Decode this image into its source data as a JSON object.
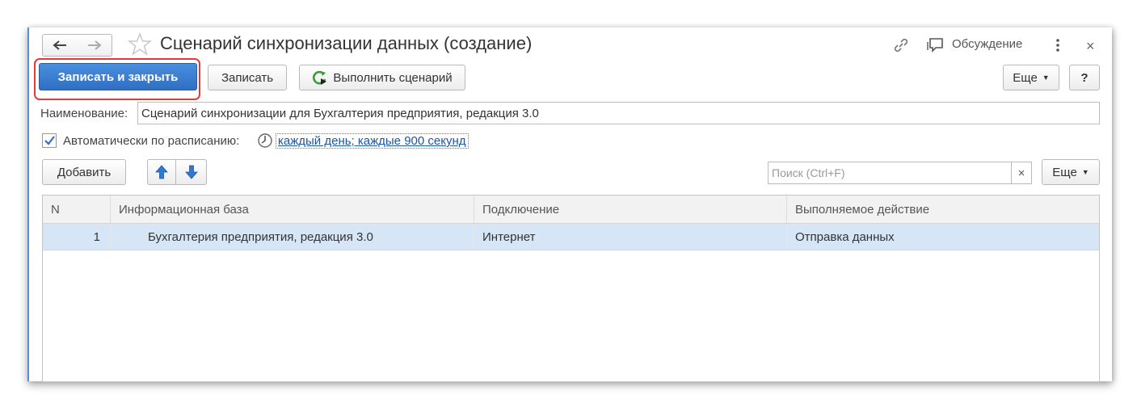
{
  "header": {
    "title": "Сценарий синхронизации данных (создание)",
    "discussion_label": "Обсуждение",
    "icons": [
      "arrow-left-icon",
      "arrow-right-icon",
      "star-icon",
      "link-icon",
      "discussion-icon",
      "more-vert-icon",
      "close-icon"
    ]
  },
  "toolbar": {
    "save_close_label": "Записать и закрыть",
    "save_label": "Записать",
    "run_scenario_label": "Выполнить сценарий",
    "more_label": "Еще",
    "help_label": "?"
  },
  "form": {
    "name_label": "Наименование:",
    "name_value": "Сценарий синхронизации для Бухгалтерия предприятия, редакция 3.0",
    "auto_schedule_label": "Автоматически по расписанию:",
    "auto_schedule_checked": true,
    "schedule_link": "каждый день; каждые 900 секунд"
  },
  "table_toolbar": {
    "add_label": "Добавить",
    "search_placeholder": "Поиск (Ctrl+F)",
    "clear_label": "×",
    "more_label": "Еще"
  },
  "table": {
    "columns": [
      "N",
      "Информационная база",
      "Подключение",
      "Выполняемое действие"
    ],
    "rows": [
      {
        "n": "1",
        "base": "Бухгалтерия предприятия, редакция 3.0",
        "connection": "Интернет",
        "action": "Отправка данных"
      }
    ]
  },
  "colors": {
    "accent": "#2f6fc4",
    "highlight": "#e23b3b",
    "selected_row": "#d6e6f7",
    "link": "#1d55a8"
  }
}
